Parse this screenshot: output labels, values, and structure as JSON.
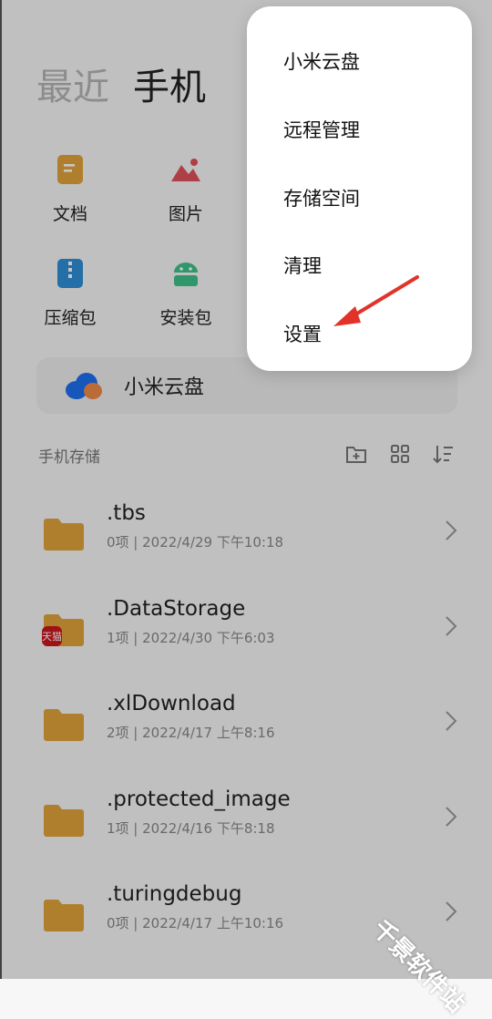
{
  "tabs": {
    "recent": "最近",
    "phone": "手机"
  },
  "categories": [
    {
      "label": "文档",
      "icon": "document-icon",
      "color": "#e0a33a"
    },
    {
      "label": "图片",
      "icon": "image-icon",
      "color": "#e0515a"
    },
    {
      "label": "压缩包",
      "icon": "zip-icon",
      "color": "#2f8fd6"
    },
    {
      "label": "安装包",
      "icon": "android-icon",
      "color": "#3ec28a"
    }
  ],
  "cloud": {
    "label": "小米云盘",
    "icon": "cloud-icon"
  },
  "storage": {
    "title": "手机存储",
    "tools": [
      "new-folder-icon",
      "grid-view-icon",
      "sort-icon"
    ]
  },
  "files": [
    {
      "name": ".tbs",
      "meta": "0项 | 2022/4/29 下午10:18"
    },
    {
      "name": ".DataStorage",
      "meta": "1项 | 2022/4/30 下午6:03",
      "badge": "天猫"
    },
    {
      "name": ".xlDownload",
      "meta": "2项 | 2022/4/17 上午8:16"
    },
    {
      "name": ".protected_image",
      "meta": "1项 | 2022/4/16 下午8:18"
    },
    {
      "name": ".turingdebug",
      "meta": "0项 | 2022/4/17 上午10:16"
    }
  ],
  "menu": {
    "items": [
      "小米云盘",
      "远程管理",
      "存储空间",
      "清理",
      "设置"
    ]
  },
  "watermark": "千景软件站",
  "colors": {
    "folder": "#e0a33a",
    "arrow": "#e2332a"
  }
}
